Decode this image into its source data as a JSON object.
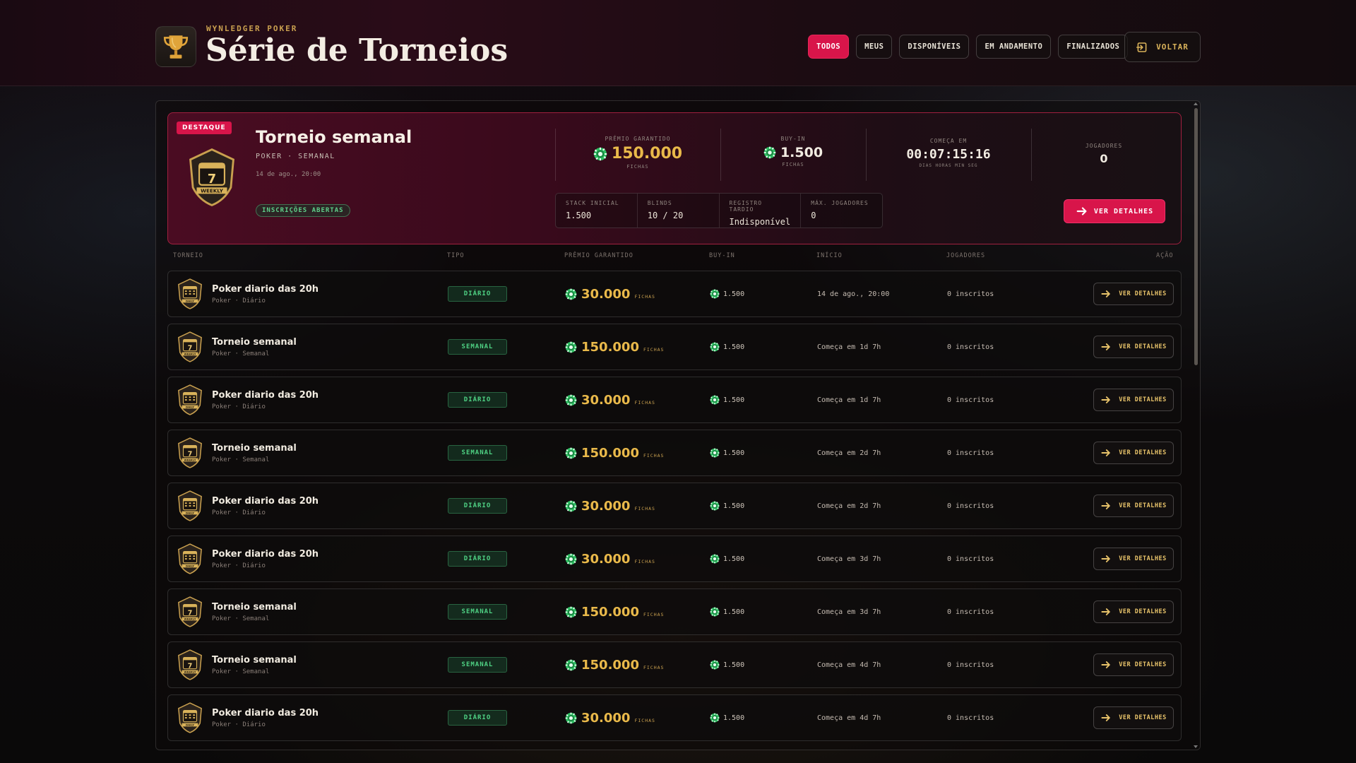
{
  "header": {
    "brand": "WYNLEDGER POKER",
    "title": "Série de Torneios",
    "filters": [
      "TODOS",
      "MEUS",
      "DISPONÍVEIS",
      "EM ANDAMENTO",
      "FINALIZADOS"
    ],
    "active_filter": "TODOS",
    "back_label": "VOLTAR"
  },
  "featured": {
    "tag": "DESTAQUE",
    "title": "Torneio semanal",
    "category": "POKER · SEMANAL",
    "date": "14 de ago., 20:00",
    "status": "INSCRIÇÕES ABERTAS",
    "badge_text": "7",
    "badge_label": "WEEKLY",
    "prize_label": "PRÊMIO GARANTIDO",
    "prize_value": "150.000",
    "prize_unit": "FICHAS",
    "buyin_label": "BUY-IN",
    "buyin_value": "1.500",
    "buyin_unit": "FICHAS",
    "start_label": "COMEÇA EM",
    "countdown": "00:07:15:16",
    "countdown_units": "DIAS HORAS MIN SEG",
    "players_label": "JOGADORES",
    "players_value": "0",
    "minis": [
      {
        "label": "STACK INICIAL",
        "value": "1.500"
      },
      {
        "label": "BLINDS",
        "value": "10 / 20"
      },
      {
        "label": "REGISTRO TARDIO",
        "value": "Indisponível"
      },
      {
        "label": "MÁX. JOGADORES",
        "value": "0"
      }
    ],
    "cta": "VER DETALHES"
  },
  "table": {
    "headers": {
      "torneio": "TORNEIO",
      "tipo": "TIPO",
      "premio": "PRÊMIO GARANTIDO",
      "buyin": "BUY-IN",
      "inicio": "INÍCIO",
      "jogadores": "JOGADORES",
      "acao": "AÇÃO"
    },
    "prize_unit": "FICHAS",
    "cta": "VER DETALHES",
    "rows": [
      {
        "name": "Poker diario das 20h",
        "category": "Poker · Diário",
        "type": "DIÁRIO",
        "kind": "daily",
        "prize": "30.000",
        "buyin": "1.500",
        "start": "14 de ago., 20:00",
        "players": "0 inscritos"
      },
      {
        "name": "Torneio semanal",
        "category": "Poker · Semanal",
        "type": "SEMANAL",
        "kind": "weekly",
        "prize": "150.000",
        "buyin": "1.500",
        "start": "Começa em 1d 7h",
        "players": "0 inscritos"
      },
      {
        "name": "Poker diario das 20h",
        "category": "Poker · Diário",
        "type": "DIÁRIO",
        "kind": "daily",
        "prize": "30.000",
        "buyin": "1.500",
        "start": "Começa em 1d 7h",
        "players": "0 inscritos"
      },
      {
        "name": "Torneio semanal",
        "category": "Poker · Semanal",
        "type": "SEMANAL",
        "kind": "weekly",
        "prize": "150.000",
        "buyin": "1.500",
        "start": "Começa em 2d 7h",
        "players": "0 inscritos"
      },
      {
        "name": "Poker diario das 20h",
        "category": "Poker · Diário",
        "type": "DIÁRIO",
        "kind": "daily",
        "prize": "30.000",
        "buyin": "1.500",
        "start": "Começa em 2d 7h",
        "players": "0 inscritos"
      },
      {
        "name": "Poker diario das 20h",
        "category": "Poker · Diário",
        "type": "DIÁRIO",
        "kind": "daily",
        "prize": "30.000",
        "buyin": "1.500",
        "start": "Começa em 3d 7h",
        "players": "0 inscritos"
      },
      {
        "name": "Torneio semanal",
        "category": "Poker · Semanal",
        "type": "SEMANAL",
        "kind": "weekly",
        "prize": "150.000",
        "buyin": "1.500",
        "start": "Começa em 3d 7h",
        "players": "0 inscritos"
      },
      {
        "name": "Torneio semanal",
        "category": "Poker · Semanal",
        "type": "SEMANAL",
        "kind": "weekly",
        "prize": "150.000",
        "buyin": "1.500",
        "start": "Começa em 4d 7h",
        "players": "0 inscritos"
      },
      {
        "name": "Poker diario das 20h",
        "category": "Poker · Diário",
        "type": "DIÁRIO",
        "kind": "daily",
        "prize": "30.000",
        "buyin": "1.500",
        "start": "Começa em 4d 7h",
        "players": "0 inscritos"
      }
    ]
  },
  "colors": {
    "accent": "#d8154a",
    "gold": "#e9b94a",
    "green": "#4fd284",
    "chip": "#2fbf63"
  },
  "icons": [
    "trophy-icon",
    "chip-icon",
    "arrow-right-icon",
    "exit-icon",
    "weekly-badge-icon",
    "daily-badge-icon"
  ]
}
